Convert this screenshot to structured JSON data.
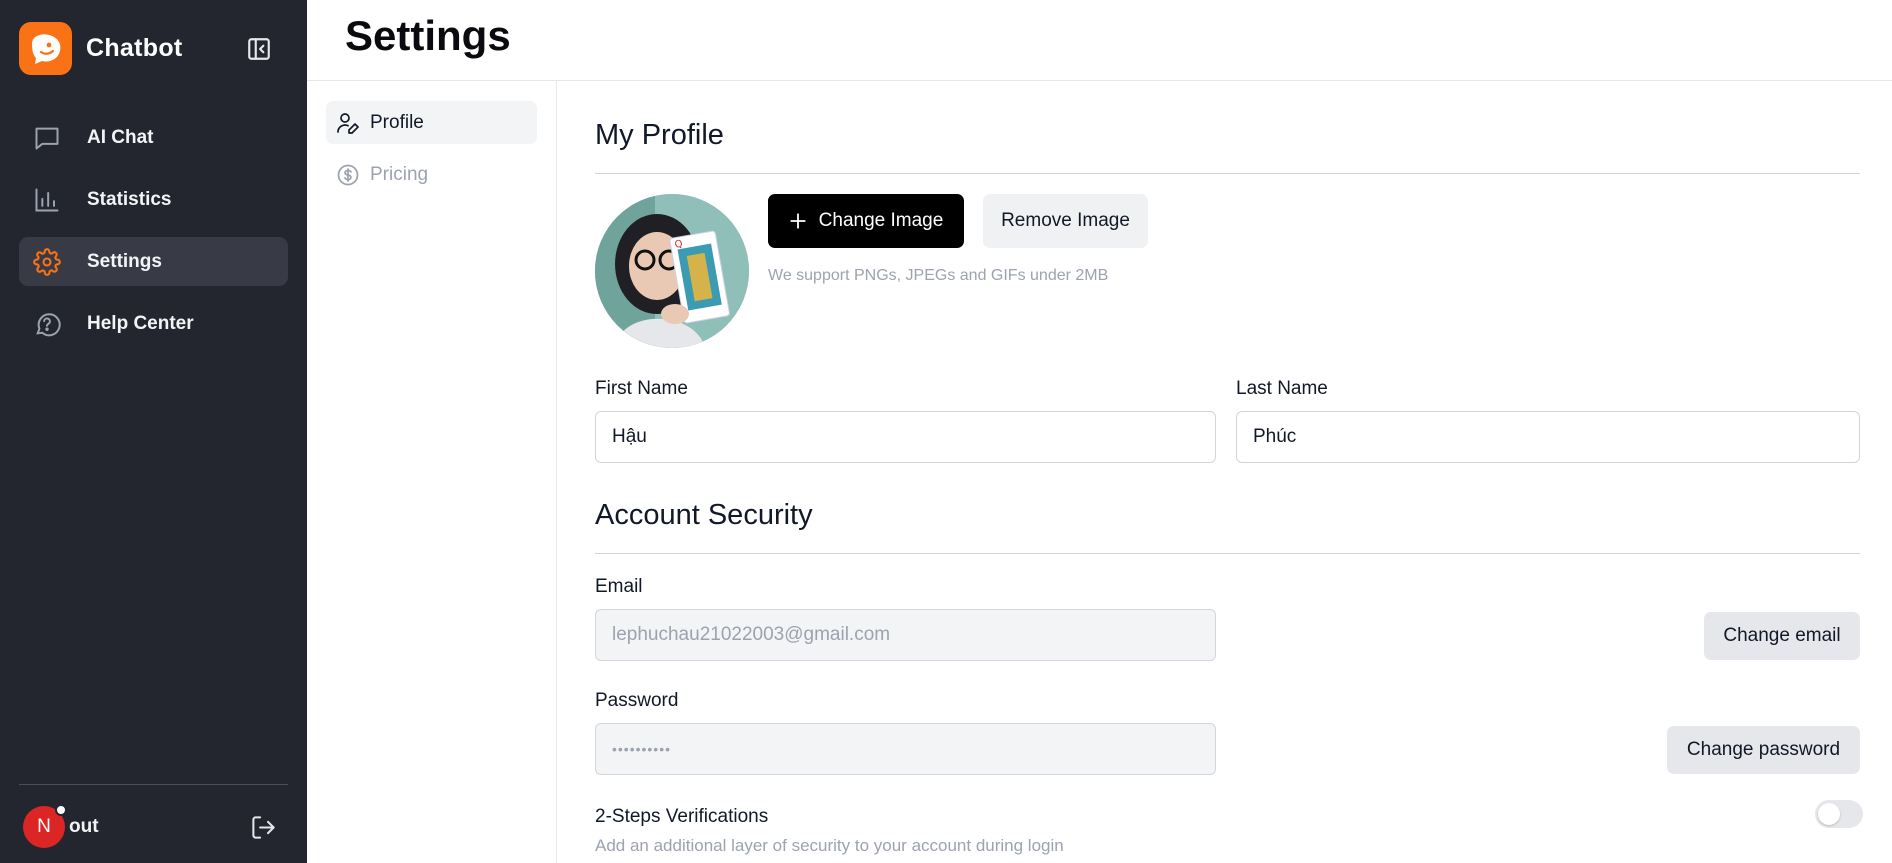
{
  "brand": {
    "name": "Chatbot",
    "accent": "#f97316"
  },
  "sidebar": {
    "items": [
      {
        "label": "AI Chat",
        "icon": "chat-bubble-icon"
      },
      {
        "label": "Statistics",
        "icon": "bar-chart-icon"
      },
      {
        "label": "Settings",
        "icon": "gear-icon",
        "active": true
      },
      {
        "label": "Help Center",
        "icon": "help-circle-icon"
      }
    ],
    "user": {
      "initial": "N",
      "name": "out"
    }
  },
  "header": {
    "title": "Settings"
  },
  "subnav": {
    "items": [
      {
        "label": "Profile",
        "icon": "user-pen-icon",
        "active": true
      },
      {
        "label": "Pricing",
        "icon": "dollar-circle-icon"
      }
    ]
  },
  "profile": {
    "title": "My Profile",
    "change_image": "Change Image",
    "remove_image": "Remove Image",
    "hint": "We support PNGs, JPEGs and GIFs under 2MB",
    "first_name_label": "First Name",
    "first_name": "Hậu",
    "last_name_label": "Last Name",
    "last_name": "Phúc"
  },
  "security": {
    "title": "Account Security",
    "email_label": "Email",
    "email": "lephuchau21022003@gmail.com",
    "change_email": "Change email",
    "password_label": "Password",
    "password": "••••••••••",
    "change_password": "Change password",
    "two_step_label": "2-Steps Verifications",
    "two_step_hint": "Add an additional layer of security to your account during login",
    "two_step_enabled": false
  }
}
